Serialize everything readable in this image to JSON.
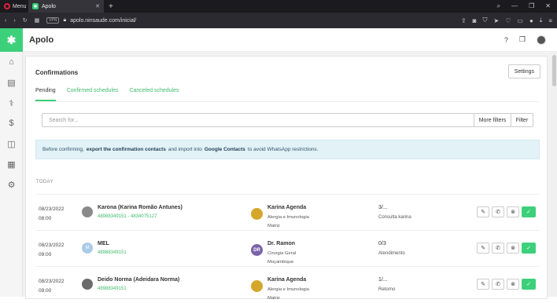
{
  "browser": {
    "menu_label": "Menu",
    "tab_title": "Apolo",
    "url": "apolo.ninsaude.com/inicial/",
    "vpn_label": "VPN"
  },
  "app": {
    "title": "Apolo",
    "logo_icon": "asterisk-logo",
    "accent_color": "#3dd07b",
    "sidebar_icons": [
      "home-icon",
      "calendar-icon",
      "stethoscope-icon",
      "dollar-icon",
      "bag-icon",
      "grid-icon",
      "gear-icon"
    ],
    "top_icons": [
      "help-icon",
      "chat-icon",
      "user-avatar"
    ]
  },
  "page": {
    "title": "Confirmations",
    "settings_label": "Settings",
    "tabs": [
      "Pending",
      "Confirmed schedules",
      "Canceled schedules"
    ],
    "search_placeholder": "Search for...",
    "more_filters_label": "More filters",
    "filter_label": "Filter",
    "info": {
      "part1": "Before confirming,",
      "bold1": "export the confirmation contacts",
      "part2": "and import into",
      "bold2": "Google Contacts",
      "part3": "to avoid WhatsApp restrictions."
    },
    "section_label": "TODAY"
  },
  "rows": [
    {
      "date": "08/23/2022",
      "time": "08:00",
      "patient": "Karona (Karina Romão Antunes)",
      "phone": "48988349151 - 4834075127",
      "patient_avatar": "",
      "doctor": "Karina Agenda",
      "specialty": "Alergia e Imunologia",
      "location": "Matriz",
      "doctor_avatar": "",
      "status": "3/...",
      "service": "Consulta karina"
    },
    {
      "date": "08/23/2022",
      "time": "09:00",
      "patient": "MEL",
      "phone": "48988349151",
      "patient_avatar": "M",
      "doctor": "Dr. Ramon",
      "specialty": "Cirurgia Geral",
      "location": "Moçambique",
      "doctor_avatar": "DR",
      "status": "0/3",
      "service": "Atendimento"
    },
    {
      "date": "08/23/2022",
      "time": "09:00",
      "patient": "Deido Norma (Adeidara Norma)",
      "phone": "48988349151",
      "patient_avatar": "",
      "doctor": "Karina Agenda",
      "specialty": "Alergia e Imunologia",
      "location": "Matriz",
      "doctor_avatar": "",
      "status": "1/...",
      "service": "Retorno"
    }
  ]
}
